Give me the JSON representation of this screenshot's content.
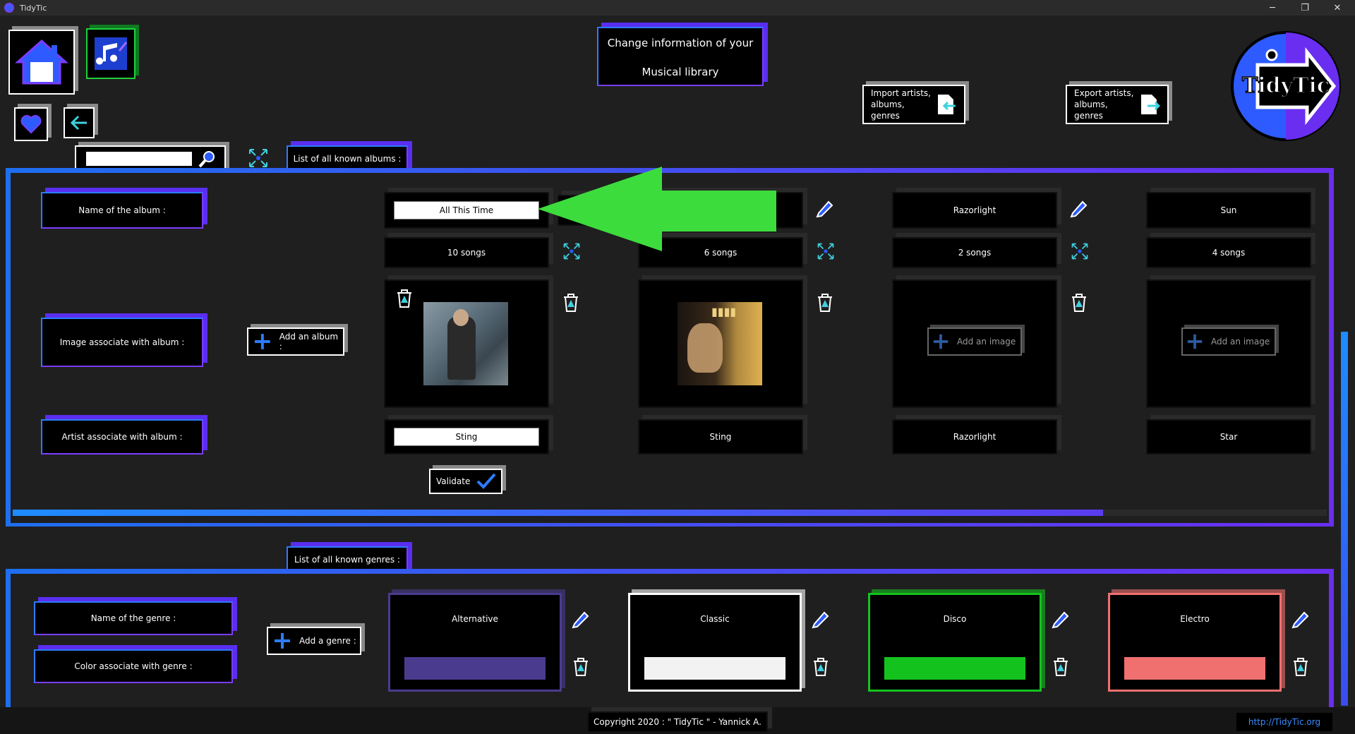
{
  "window": {
    "title": "TidyTic",
    "minimize": "─",
    "maximize": "❐",
    "close": "✕"
  },
  "header": {
    "title_line1": "Change information of your",
    "title_line2": "Musical library",
    "import_label_l1": "Import artists,",
    "import_label_l2": "albums, genres",
    "export_label_l1": "Export artists,",
    "export_label_l2": "albums, genres",
    "logo_text": "TidyTic"
  },
  "search": {
    "value": ""
  },
  "albums_section": {
    "tab_label": "List of all known albums :",
    "name_label": "Name of the album :",
    "image_label": "Image associate with album :",
    "artist_label": "Artist associate with album :",
    "add_album_label": "Add an album :",
    "validate_label": "Validate",
    "scroll_progress": 0.83,
    "albums": [
      {
        "name": "All This Time",
        "songs": "10 songs",
        "artist": "Sting",
        "editing": true
      },
      {
        "name": "",
        "songs": "6 songs",
        "artist": "Sting",
        "editing": false
      },
      {
        "name": "Razorlight",
        "songs": "2 songs",
        "artist": "Razorlight",
        "editing": false,
        "add_image": "Add an image"
      },
      {
        "name": "Sun",
        "songs": "4 songs",
        "artist": "Star",
        "editing": false,
        "add_image": "Add an image"
      }
    ]
  },
  "genres_section": {
    "tab_label": "List of all known genres :",
    "name_label": "Name of the genre :",
    "color_label": "Color associate with genre :",
    "add_genre_label": "Add a genre :",
    "genres": [
      {
        "name": "Alternative",
        "color": "#4b3b8f",
        "border": "#4b3b8f"
      },
      {
        "name": "Classic",
        "color": "#f2f2f2",
        "border": "#ffffff"
      },
      {
        "name": "Disco",
        "color": "#14c21e",
        "border": "#14c21e"
      },
      {
        "name": "Electro",
        "color": "#f07070",
        "border": "#f07070"
      }
    ]
  },
  "footer": {
    "copyright": "Copyright 2020 : \" TidyTic \" - Yannick A.",
    "link": "http://TidyTic.org"
  },
  "colors": {
    "accent_blue": "#1e6ff0",
    "accent_purple": "#6a2ef0",
    "arrow_green": "#3ddc3d"
  }
}
